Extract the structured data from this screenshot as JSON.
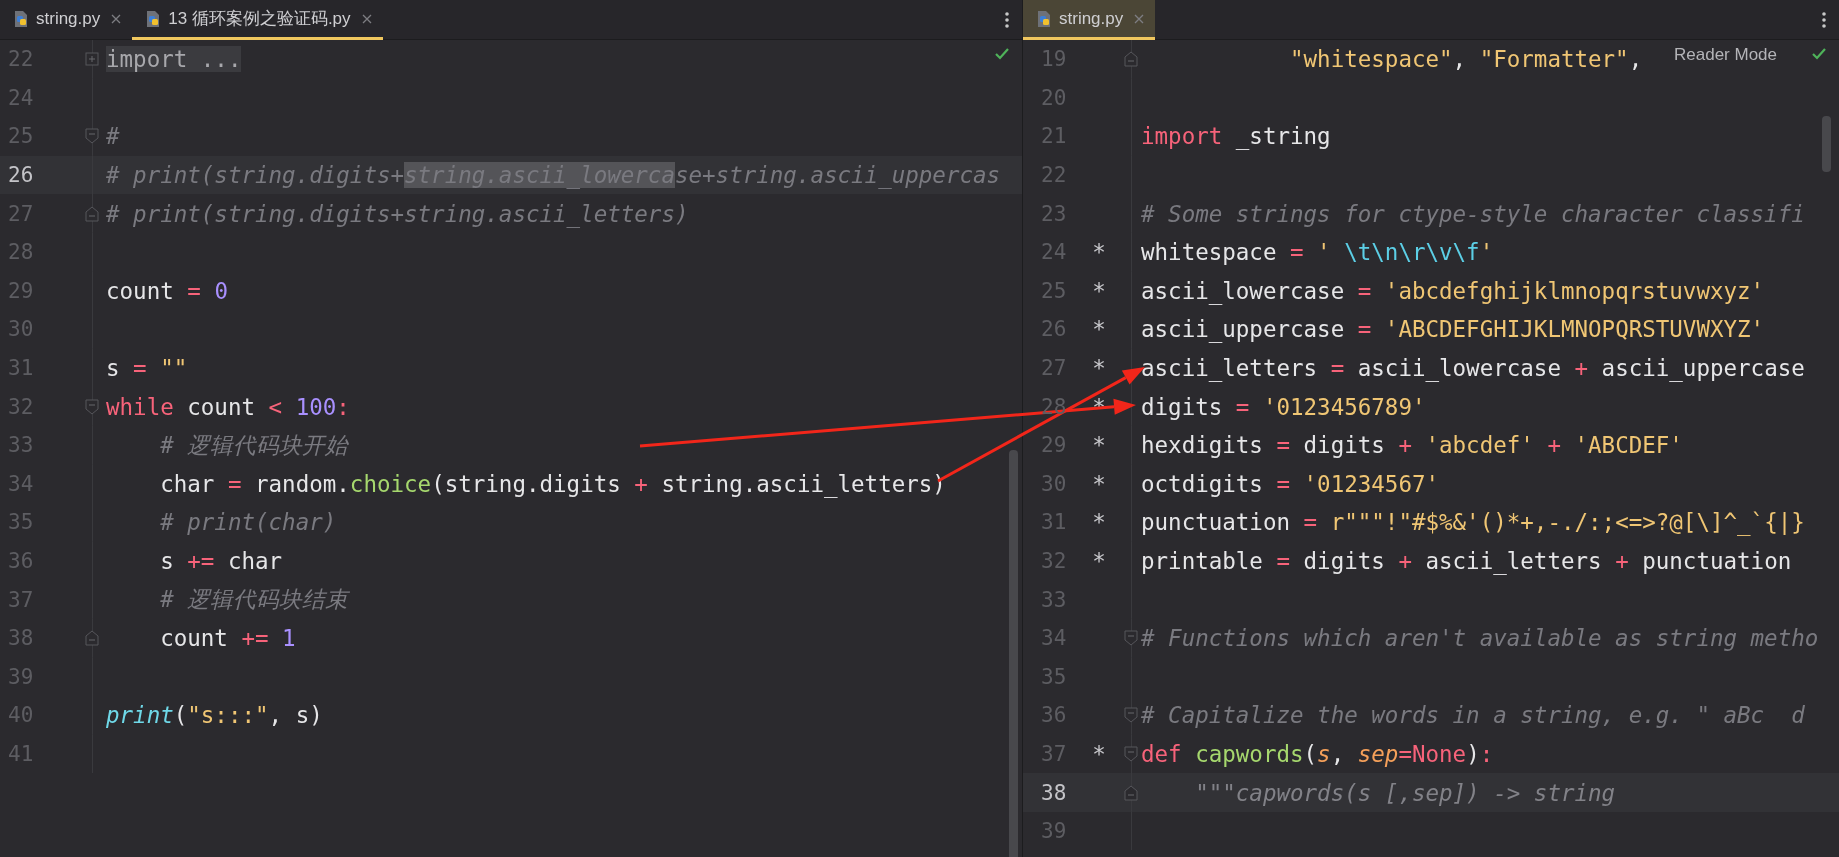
{
  "panes": [
    {
      "tabs": [
        {
          "label": "string.py",
          "selected": false
        },
        {
          "label": "13 循环案例之验证码.py",
          "selected": true
        }
      ],
      "lines": [
        {
          "number": "22",
          "current": false,
          "fold": {
            "kind": "collapsed"
          },
          "tokens": [
            {
              "kind": "folded",
              "text": "import ..."
            }
          ]
        },
        {
          "number": "24",
          "current": false
        },
        {
          "number": "25",
          "current": false,
          "fold": {
            "kind": "open"
          },
          "tokens": [
            {
              "kind": "comment",
              "text": "#"
            }
          ]
        },
        {
          "number": "26",
          "current": true,
          "tokens": [
            {
              "kind": "comment",
              "text": "# print(string.digits+"
            },
            {
              "kind": "selected-comment",
              "text": "string.ascii_lowerca"
            },
            {
              "kind": "comment",
              "text": "se+string.ascii_uppercas"
            }
          ]
        },
        {
          "number": "27",
          "current": false,
          "fold": {
            "kind": "end"
          },
          "tokens": [
            {
              "kind": "comment",
              "text": "# print(string.digits+string.ascii_letters)"
            }
          ]
        },
        {
          "number": "28",
          "current": false
        },
        {
          "number": "29",
          "current": false,
          "tokens": [
            {
              "kind": "name",
              "text": "count "
            },
            {
              "kind": "operator",
              "text": "= "
            },
            {
              "kind": "number",
              "text": "0"
            }
          ]
        },
        {
          "number": "30",
          "current": false
        },
        {
          "number": "31",
          "current": false,
          "tokens": [
            {
              "kind": "name",
              "text": "s "
            },
            {
              "kind": "operator",
              "text": "= "
            },
            {
              "kind": "string",
              "text": "\"\""
            }
          ]
        },
        {
          "number": "32",
          "current": false,
          "fold": {
            "kind": "open"
          },
          "tokens": [
            {
              "kind": "keyword",
              "text": "while"
            },
            {
              "kind": "name",
              "text": " count "
            },
            {
              "kind": "operator",
              "text": "< "
            },
            {
              "kind": "number",
              "text": "100"
            },
            {
              "kind": "operator",
              "text": ":"
            }
          ]
        },
        {
          "number": "33",
          "current": false,
          "tokens": [
            {
              "kind": "comment",
              "text": "    # 逻辑代码块开始"
            }
          ]
        },
        {
          "number": "34",
          "current": false,
          "tokens": [
            {
              "kind": "name",
              "text": "    char "
            },
            {
              "kind": "operator",
              "text": "="
            },
            {
              "kind": "name",
              "text": " random."
            },
            {
              "kind": "function",
              "text": "choice"
            },
            {
              "kind": "name",
              "text": "(string.digits "
            },
            {
              "kind": "operator",
              "text": "+"
            },
            {
              "kind": "name",
              "text": " string.ascii_letters)"
            }
          ]
        },
        {
          "number": "35",
          "current": false,
          "tokens": [
            {
              "kind": "comment",
              "text": "    # print(char)"
            }
          ]
        },
        {
          "number": "36",
          "current": false,
          "tokens": [
            {
              "kind": "name",
              "text": "    s "
            },
            {
              "kind": "operator",
              "text": "+="
            },
            {
              "kind": "name",
              "text": " char"
            }
          ]
        },
        {
          "number": "37",
          "current": false,
          "tokens": [
            {
              "kind": "comment",
              "text": "    # 逻辑代码块结束"
            }
          ]
        },
        {
          "number": "38",
          "current": false,
          "fold": {
            "kind": "end"
          },
          "tokens": [
            {
              "kind": "name",
              "text": "    count "
            },
            {
              "kind": "operator",
              "text": "+= "
            },
            {
              "kind": "number",
              "text": "1"
            }
          ]
        },
        {
          "number": "39",
          "current": false
        },
        {
          "number": "40",
          "current": false,
          "tokens": [
            {
              "kind": "builtin",
              "text": "print"
            },
            {
              "kind": "name",
              "text": "("
            },
            {
              "kind": "string",
              "text": "\"s:::\""
            },
            {
              "kind": "name",
              "text": ", s)"
            }
          ]
        },
        {
          "number": "41",
          "current": false
        }
      ]
    },
    {
      "tabs": [
        {
          "label": "string.py",
          "selected": true
        }
      ],
      "reader_mode": "Reader Mode",
      "lines": [
        {
          "number": "19",
          "current": false,
          "fold": {
            "kind": "end"
          },
          "tokens": [
            {
              "kind": "string",
              "text": "           \"whitespace\""
            },
            {
              "kind": "name",
              "text": ", "
            },
            {
              "kind": "string",
              "text": "\"Formatter\""
            },
            {
              "kind": "name",
              "text": ","
            }
          ]
        },
        {
          "number": "20",
          "current": false
        },
        {
          "number": "21",
          "current": false,
          "tokens": [
            {
              "kind": "keyword",
              "text": "import"
            },
            {
              "kind": "name",
              "text": " _string"
            }
          ]
        },
        {
          "number": "22",
          "current": false
        },
        {
          "number": "23",
          "current": false,
          "tokens": [
            {
              "kind": "comment",
              "text": "# Some strings for ctype-style character classifi"
            }
          ]
        },
        {
          "number": "24",
          "current": false,
          "marker": "*",
          "tokens": [
            {
              "kind": "name",
              "text": "whitespace "
            },
            {
              "kind": "operator",
              "text": "= "
            },
            {
              "kind": "string",
              "text": "' "
            },
            {
              "kind": "escape",
              "text": "\\t\\n\\r\\v\\f"
            },
            {
              "kind": "string",
              "text": "'"
            }
          ]
        },
        {
          "number": "25",
          "current": false,
          "marker": "*",
          "tokens": [
            {
              "kind": "name",
              "text": "ascii_lowercase "
            },
            {
              "kind": "operator",
              "text": "= "
            },
            {
              "kind": "string",
              "text": "'abcdefghijklmnopqrstuvwxyz'"
            }
          ]
        },
        {
          "number": "26",
          "current": false,
          "marker": "*",
          "tokens": [
            {
              "kind": "name",
              "text": "ascii_uppercase "
            },
            {
              "kind": "operator",
              "text": "= "
            },
            {
              "kind": "string",
              "text": "'ABCDEFGHIJKLMNOPQRSTUVWXYZ'"
            }
          ]
        },
        {
          "number": "27",
          "current": false,
          "marker": "*",
          "tokens": [
            {
              "kind": "name",
              "text": "ascii_letters "
            },
            {
              "kind": "operator",
              "text": "="
            },
            {
              "kind": "name",
              "text": " ascii_lowercase "
            },
            {
              "kind": "operator",
              "text": "+"
            },
            {
              "kind": "name",
              "text": " ascii_uppercase"
            }
          ]
        },
        {
          "number": "28",
          "current": false,
          "marker": "*",
          "tokens": [
            {
              "kind": "name",
              "text": "digits "
            },
            {
              "kind": "operator",
              "text": "= "
            },
            {
              "kind": "string",
              "text": "'0123456789'"
            }
          ]
        },
        {
          "number": "29",
          "current": false,
          "marker": "*",
          "tokens": [
            {
              "kind": "name",
              "text": "hexdigits "
            },
            {
              "kind": "operator",
              "text": "="
            },
            {
              "kind": "name",
              "text": " digits "
            },
            {
              "kind": "operator",
              "text": "+ "
            },
            {
              "kind": "string",
              "text": "'abcdef'"
            },
            {
              "kind": "operator",
              "text": " + "
            },
            {
              "kind": "string",
              "text": "'ABCDEF'"
            }
          ]
        },
        {
          "number": "30",
          "current": false,
          "marker": "*",
          "tokens": [
            {
              "kind": "name",
              "text": "octdigits "
            },
            {
              "kind": "operator",
              "text": "= "
            },
            {
              "kind": "string",
              "text": "'01234567'"
            }
          ]
        },
        {
          "number": "31",
          "current": false,
          "marker": "*",
          "tokens": [
            {
              "kind": "name",
              "text": "punctuation "
            },
            {
              "kind": "operator",
              "text": "= "
            },
            {
              "kind": "string",
              "text": "r\"\"\"!\"#$%&'()*+,-./:;<=>?@[\\]^_`{|}"
            }
          ]
        },
        {
          "number": "32",
          "current": false,
          "marker": "*",
          "tokens": [
            {
              "kind": "name",
              "text": "printable "
            },
            {
              "kind": "operator",
              "text": "="
            },
            {
              "kind": "name",
              "text": " digits "
            },
            {
              "kind": "operator",
              "text": "+"
            },
            {
              "kind": "name",
              "text": " ascii_letters "
            },
            {
              "kind": "operator",
              "text": "+"
            },
            {
              "kind": "name",
              "text": " punctuation"
            }
          ]
        },
        {
          "number": "33",
          "current": false
        },
        {
          "number": "34",
          "current": false,
          "fold": {
            "kind": "open"
          },
          "tokens": [
            {
              "kind": "comment",
              "text": "# Functions which aren't available as string metho"
            }
          ]
        },
        {
          "number": "35",
          "current": false
        },
        {
          "number": "36",
          "current": false,
          "fold": {
            "kind": "open"
          },
          "tokens": [
            {
              "kind": "comment",
              "text": "# Capitalize the words in a string, e.g. \" aBc  d"
            }
          ]
        },
        {
          "number": "37",
          "current": false,
          "marker": "*",
          "fold": {
            "kind": "open"
          },
          "tokens": [
            {
              "kind": "keyword",
              "text": "def"
            },
            {
              "kind": "function",
              "text": " capwords"
            },
            {
              "kind": "name",
              "text": "("
            },
            {
              "kind": "param",
              "text": "s"
            },
            {
              "kind": "name",
              "text": ", "
            },
            {
              "kind": "param",
              "text": "sep"
            },
            {
              "kind": "operator",
              "text": "="
            },
            {
              "kind": "keyword",
              "text": "None"
            },
            {
              "kind": "name",
              "text": ")"
            },
            {
              "kind": "operator",
              "text": ":"
            }
          ]
        },
        {
          "number": "38",
          "current": true,
          "fold": {
            "kind": "end"
          },
          "tokens": [
            {
              "kind": "docstring",
              "text": "    \"\"\"capwords(s [,sep]) -> string"
            }
          ]
        },
        {
          "number": "39",
          "current": false
        }
      ]
    }
  ]
}
